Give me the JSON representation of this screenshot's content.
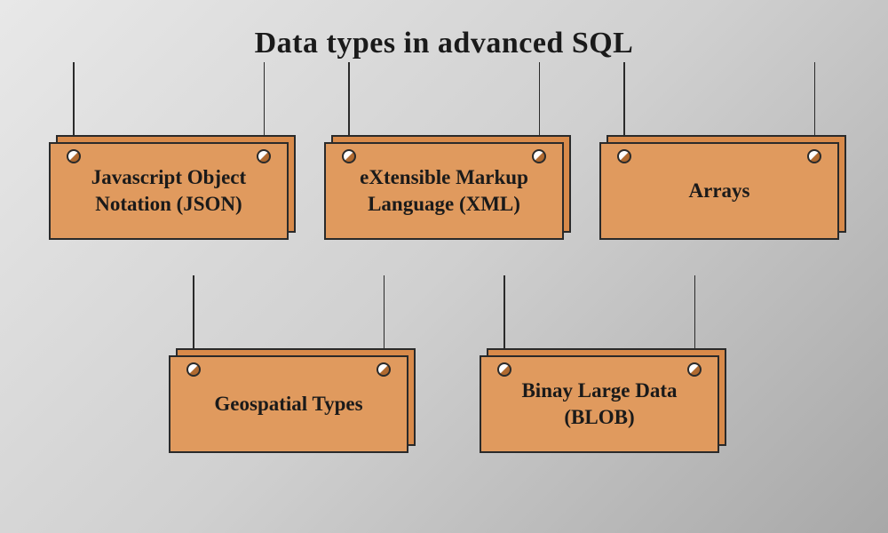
{
  "title": "Data types in advanced SQL",
  "cards": {
    "json": "Javascript Object Notation (JSON)",
    "xml": "eXtensible Markup Language (XML)",
    "arrays": "Arrays",
    "geospatial": "Geospatial Types",
    "blob": "Binay Large Data (BLOB)"
  }
}
